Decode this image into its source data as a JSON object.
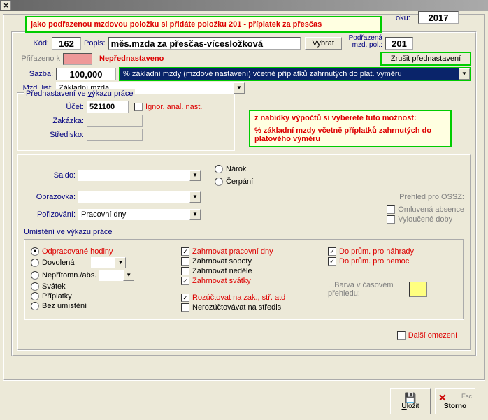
{
  "tooltip_top": "jako podřazenou mzdovou položku si přidáte položku 201 - příplatek za přesčas",
  "tooltip_right": "z nabídky výpočtů si vyberete tuto možnost:",
  "tooltip_right2": "% základní mzdy včetně příplatků zahrnutých do platového výměru",
  "year_label": "oku:",
  "year_value": "2017",
  "kod_label": "Kód:",
  "kod_value": "162",
  "popis_label": "Popis:",
  "popis_value": "měs.mzda za přesčas-vícesložková",
  "btn_vybrat": "Vybrat",
  "podrazena_label": "Podřazená\nmzd. pol.:",
  "podrazena_value": "201",
  "prirazeno_label": "Přiřazeno k",
  "neprednastaveno": "Nepřednastaveno",
  "btn_zrusit": "Zrušit přednastavení",
  "sazba_label": "Sazba:",
  "sazba_value": "100,000",
  "sazba_dropdown": "% základní mzdy (mzdové nastavení) včetně příplatků zahrnutých do plat. výměru",
  "mzdlist_label": "Mzd. list:",
  "mzdlist_value": "Základní mzda",
  "fieldset1_title": "Přednastavení ve výkazu práce",
  "ucet_label": "Účet:",
  "ucet_value": "521100",
  "ignor_chk": "Ignor. anal. nast.",
  "zakazka_label": "Zakázka:",
  "stredisko_label": "Středisko:",
  "saldo_label": "Saldo:",
  "narok": "Nárok",
  "cerpani": "Čerpání",
  "obrazovka_label": "Obrazovka:",
  "porizovani_label": "Pořizování:",
  "porizovani_value": "Pracovní dny",
  "prehled_ossz": "Přehled pro OSSZ:",
  "omluvena": "Omluvená absence",
  "vyloucene": "Vyloučené doby",
  "umisteni_label": "Umístění ve výkazu práce",
  "r_odprac": "Odpracované hodiny",
  "r_dov": "Dovolená",
  "r_nepr": "Nepřítomn./abs.",
  "r_svatek": "Svátek",
  "r_prip": "Příplatky",
  "r_bez": "Bez umístění",
  "c_zahrprac": "Zahrnovat pracovní dny",
  "c_zahrsob": "Zahrnovat soboty",
  "c_zahrned": "Zahrnovat neděle",
  "c_zahrsva": "Zahrnovat svátky",
  "c_rozuct": "Rozúčtovat na zak., stř. atd",
  "c_nerozuct": "Nerozúčtovávat na středis",
  "c_donahr": "Do prům. pro náhrady",
  "c_donemoc": "Do prům. pro nemoc",
  "barva_label": "...Barva v časovém přehledu:",
  "dalsi_omezeni": "Další omezení",
  "btn_ulozit": "Uložit",
  "btn_storno": "Storno",
  "esc_label": "Esc"
}
